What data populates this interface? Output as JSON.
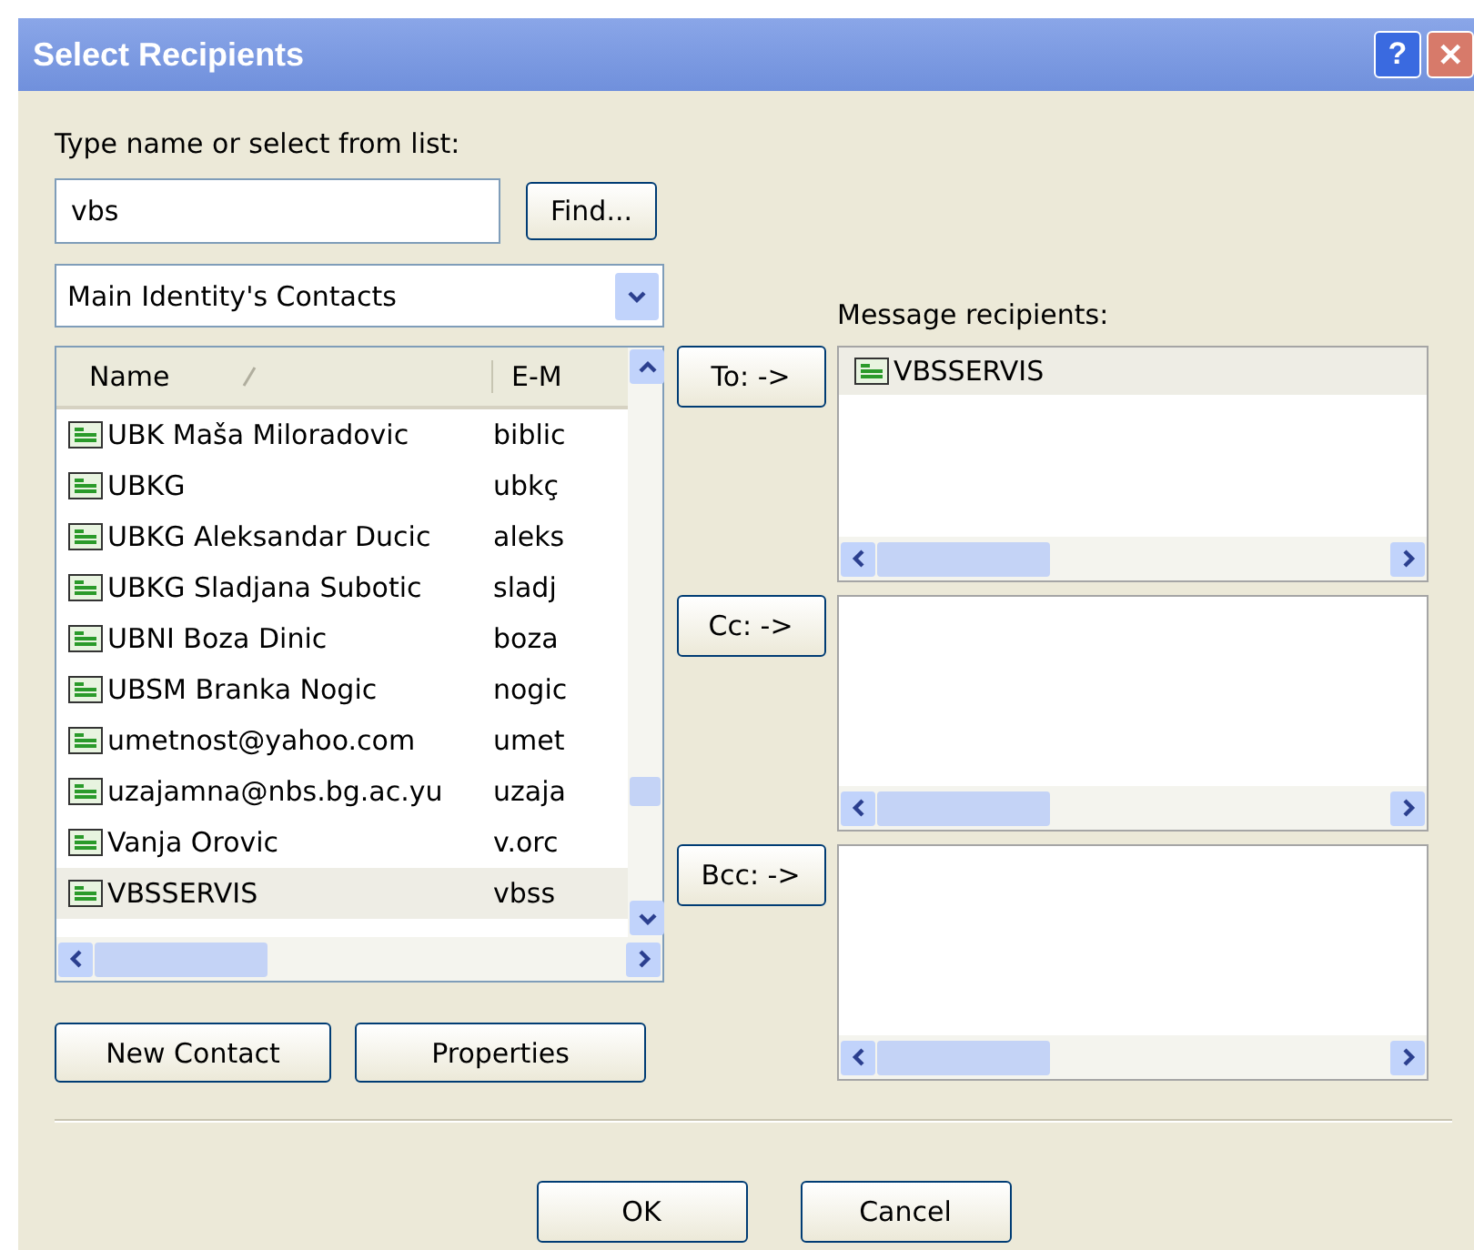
{
  "window": {
    "title": "Select Recipients",
    "help": "?",
    "close": "✕"
  },
  "search": {
    "label": "Type name or select from list:",
    "value": "vbs",
    "find_button": "Find..."
  },
  "address_book": {
    "value": "Main Identity's Contacts"
  },
  "contacts": {
    "columns": [
      "Name",
      "E-M"
    ],
    "rows": [
      {
        "name": "UBK Maša Miloradovic",
        "email": "biblic",
        "selected": false
      },
      {
        "name": "UBKG",
        "email": "ubkç",
        "selected": false
      },
      {
        "name": "UBKG Aleksandar Ducic",
        "email": "aleks",
        "selected": false
      },
      {
        "name": "UBKG Sladjana Subotic",
        "email": "sladj",
        "selected": false
      },
      {
        "name": "UBNI Boza Dinic",
        "email": "boza",
        "selected": false
      },
      {
        "name": "UBSM Branka Nogic",
        "email": "nogic",
        "selected": false
      },
      {
        "name": "umetnost@yahoo.com",
        "email": "umet",
        "selected": false
      },
      {
        "name": "uzajamna@nbs.bg.ac.yu",
        "email": "uzaja",
        "selected": false
      },
      {
        "name": "Vanja Orovic",
        "email": "v.orc",
        "selected": false
      },
      {
        "name": "VBSSERVIS",
        "email": "vbss",
        "selected": true
      }
    ]
  },
  "contact_buttons": [
    "New Contact",
    "Properties"
  ],
  "recipients": {
    "label": "Message recipients:",
    "groups": [
      {
        "button": "To: ->",
        "entries": [
          {
            "name": "VBSSERVIS",
            "selected": true
          }
        ]
      },
      {
        "button": "Cc: ->"
      },
      {
        "button": "Bcc: ->"
      }
    ]
  },
  "buttons": [
    "OK",
    "Cancel"
  ]
}
